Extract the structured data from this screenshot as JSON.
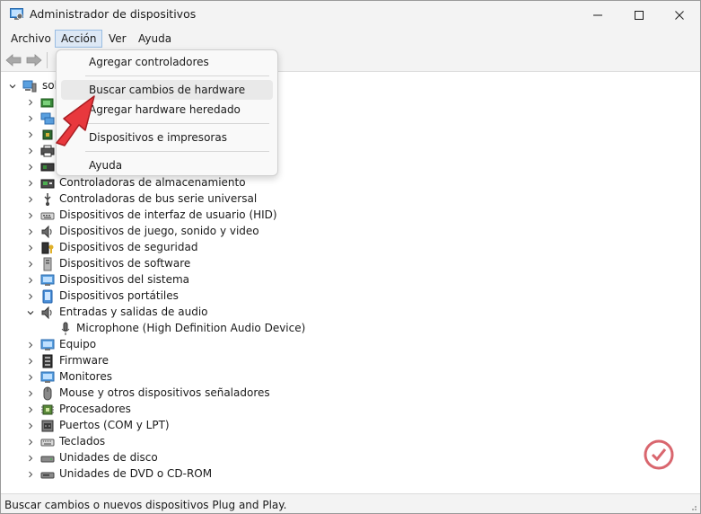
{
  "window": {
    "title": "Administrador de dispositivos"
  },
  "menubar": {
    "items": [
      "Archivo",
      "Acción",
      "Ver",
      "Ayuda"
    ]
  },
  "action_menu": {
    "items": [
      "Agregar controladores",
      "Buscar cambios de hardware",
      "Agregar hardware heredado",
      "Dispositivos e impresoras",
      "Ayuda"
    ]
  },
  "tree": {
    "root": "sol",
    "categories": [
      "Controladoras de almacenamiento",
      "Controladoras de bus serie universal",
      "Dispositivos de interfaz de usuario (HID)",
      "Dispositivos de juego, sonido y video",
      "Dispositivos de seguridad",
      "Dispositivos de software",
      "Dispositivos del sistema",
      "Dispositivos portátiles",
      "Entradas y salidas de audio",
      "Microphone (High Definition Audio Device)",
      "Equipo",
      "Firmware",
      "Monitores",
      "Mouse y otros dispositivos señaladores",
      "Procesadores",
      "Puertos (COM y LPT)",
      "Teclados",
      "Unidades de disco",
      "Unidades de DVD o CD-ROM"
    ]
  },
  "status": {
    "text": "Buscar cambios o nuevos dispositivos Plug and Play."
  },
  "colors": {
    "accent_arrow": "#e8383d",
    "menu_active_bg": "#dde8f5",
    "watermark": "#d24b55"
  }
}
